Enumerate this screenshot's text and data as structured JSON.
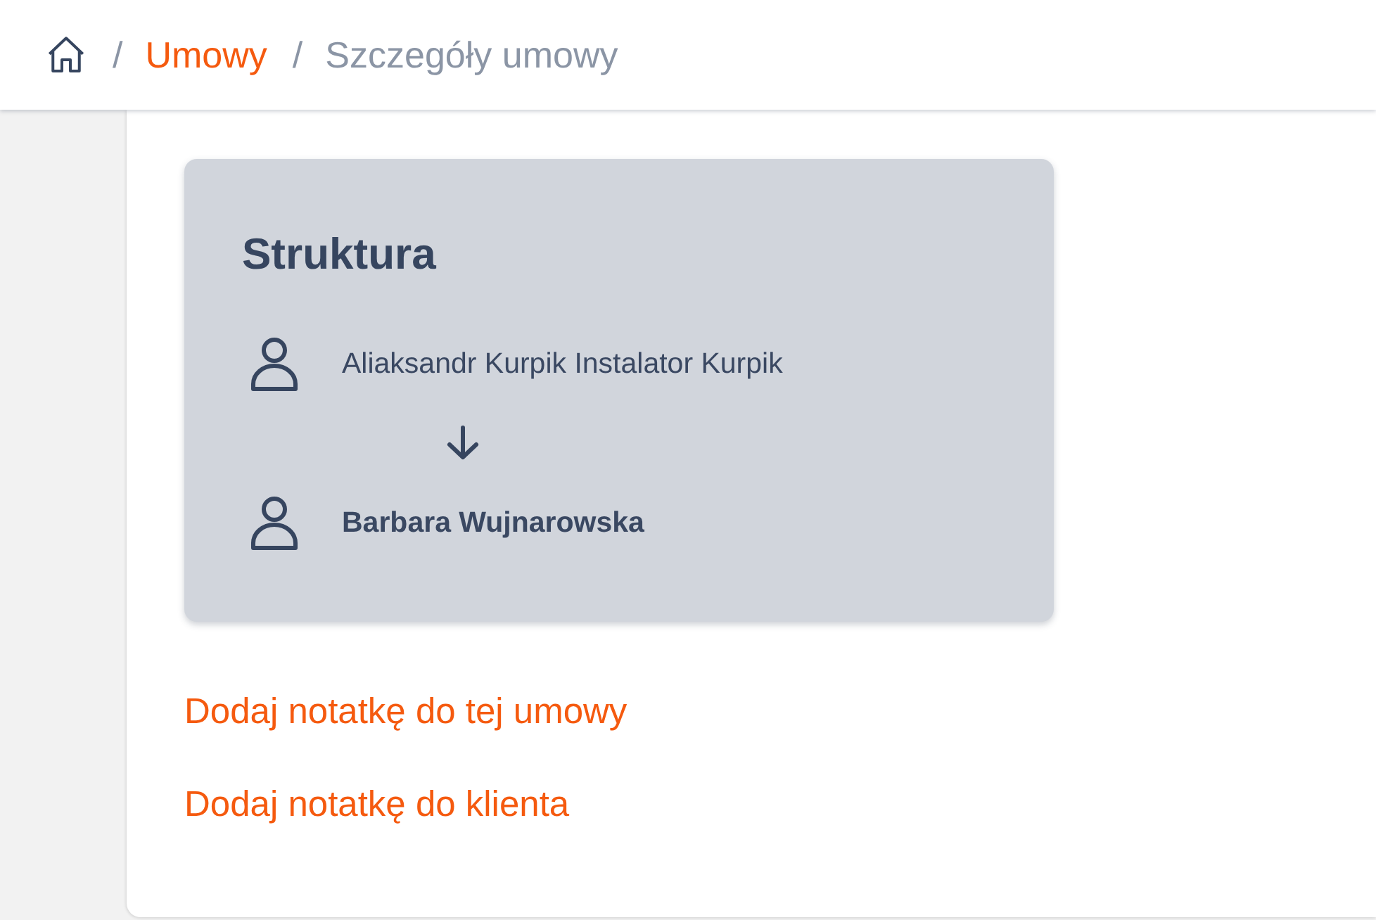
{
  "breadcrumb": {
    "items": [
      {
        "kind": "home"
      },
      {
        "kind": "link",
        "separator": "/",
        "label": "Umowy"
      },
      {
        "kind": "current",
        "separator": "/",
        "label": "Szczegóły umowy"
      }
    ]
  },
  "structure": {
    "title": "Struktura",
    "people": [
      {
        "name": "Aliaksandr Kurpik Instalator Kurpik",
        "emphasized": false
      },
      {
        "name": "Barbara Wujnarowska",
        "emphasized": true
      }
    ]
  },
  "links": [
    {
      "label": "Dodaj notatkę do tej umowy"
    },
    {
      "label": "Dodaj notatkę do klienta"
    }
  ]
}
